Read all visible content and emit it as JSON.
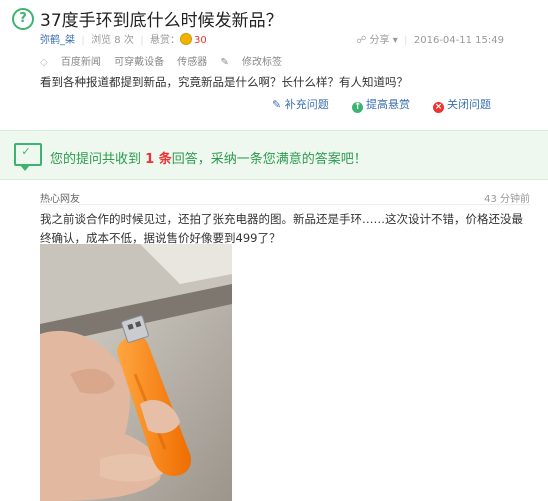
{
  "question": {
    "title": "37度手环到底什么时候发新品？",
    "author": "弥鹤_桀",
    "views_label": "浏览 8 次",
    "reward_label": "悬赏：",
    "reward_value": "30",
    "share_label": "分享",
    "datetime": "2016-04-11 15:49",
    "tags": [
      "百度新闻",
      "可穿戴设备",
      "传感器"
    ],
    "edit_tags_label": "修改标签",
    "description": "看到各种报道都提到新品，究竟新品是什么啊？长什么样？有人知道吗？"
  },
  "actions": {
    "supplement": "补充问题",
    "raise_reward": "提高悬赏",
    "close": "关闭问题"
  },
  "banner": {
    "prefix": "您的提问共收到 ",
    "count": "1 条",
    "suffix": "回答，采纳一条您满意的答案吧！"
  },
  "answer": {
    "user": "热心网友",
    "time": "43 分钟前",
    "text": "我之前谈合作的时候见过，还拍了张充电器的图。新品还是手环……这次设计不错，价格还没最终确认，成本不低，据说售价好像要到499了？"
  },
  "colors": {
    "accent_green": "#3cb371",
    "link_blue": "#3a6fb0",
    "highlight_red": "#e33333",
    "charger_orange": "#ff8a1e"
  }
}
